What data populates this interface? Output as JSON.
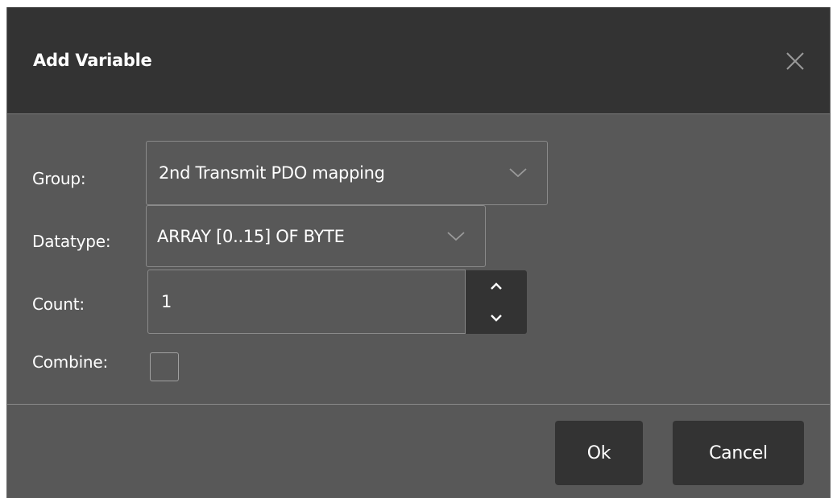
{
  "dialog": {
    "title": "Add Variable",
    "close_icon": "close-icon"
  },
  "form": {
    "group": {
      "label": "Group:",
      "value": "2nd Transmit PDO mapping"
    },
    "datatype": {
      "label": "Datatype:",
      "value": "ARRAY [0..15] OF BYTE"
    },
    "count": {
      "label": "Count:",
      "value": "1"
    },
    "combine": {
      "label": "Combine:",
      "checked": false
    }
  },
  "footer": {
    "ok_label": "Ok",
    "cancel_label": "Cancel"
  },
  "colors": {
    "header_bg": "#333333",
    "body_bg": "#585858",
    "button_bg": "#333333",
    "text": "#ffffff"
  }
}
